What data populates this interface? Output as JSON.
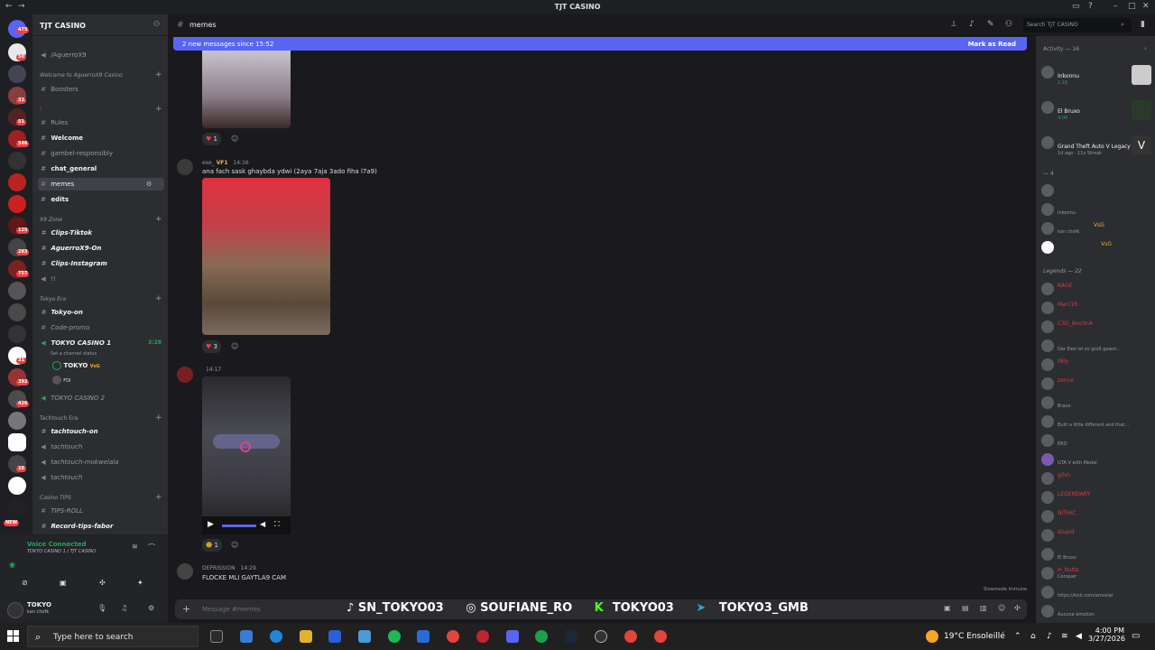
{
  "window": {
    "title": "TJT CASINO"
  },
  "server": {
    "name": "TJT CASINO",
    "badges": [
      "475",
      "50",
      "33",
      "51",
      "546",
      "125",
      "283",
      "757",
      "31",
      "392",
      "426",
      "10",
      "NEW"
    ]
  },
  "channels": {
    "items": [
      {
        "label": "/AguerroX9",
        "type": "text"
      },
      {
        "label": "Welcome to AguerroX9 Casino",
        "type": "category"
      },
      {
        "label": "Boosters",
        "type": "text"
      },
      {
        "label": "!",
        "type": "category"
      },
      {
        "label": "Rules",
        "type": "text"
      },
      {
        "label": "Welcome",
        "type": "text"
      },
      {
        "label": "gambel-responsibly",
        "type": "text"
      },
      {
        "label": "chat_general",
        "type": "text"
      },
      {
        "label": "memes",
        "type": "text"
      },
      {
        "label": "edits",
        "type": "text"
      },
      {
        "label": "X9 Zone",
        "type": "category"
      },
      {
        "label": "Clips-Tiktok",
        "type": "text"
      },
      {
        "label": "AguerroX9-On",
        "type": "text"
      },
      {
        "label": "Clips-Instagram",
        "type": "text"
      },
      {
        "label": "!!",
        "type": "text"
      },
      {
        "label": "Tokyo Era",
        "type": "category"
      },
      {
        "label": "Tokyo-on",
        "type": "text"
      },
      {
        "label": "Code-promo",
        "type": "text"
      },
      {
        "label": "TOKYO CASINO 1",
        "type": "voice"
      },
      {
        "label": "Set a channel status",
        "type": "sub"
      },
      {
        "label": "TOKYO",
        "type": "user"
      },
      {
        "label": "TOKYO CASINO 2",
        "type": "voice"
      },
      {
        "label": "Tachtouch Era",
        "type": "category"
      },
      {
        "label": "tachtouch-on",
        "type": "text"
      },
      {
        "label": "tachtouch",
        "type": "text"
      },
      {
        "label": "tachtouch-mokwelala",
        "type": "text"
      },
      {
        "label": "tachtouch",
        "type": "text"
      },
      {
        "label": "Casino TIPS",
        "type": "category"
      },
      {
        "label": "TIPS-ROLL",
        "type": "text"
      },
      {
        "label": "Record-tips-fabor",
        "type": "text"
      }
    ],
    "voice_time": "3:28",
    "vs_badge": "VsG",
    "fdi_badge": "FDI"
  },
  "voice": {
    "status": "Voice Connected",
    "channel": "TOKYO CASINO 1 / TJT CASINO"
  },
  "user": {
    "name": "TOKYO",
    "status": "kan chofk"
  },
  "chat": {
    "channel_name": "memes",
    "banner_text": "2 new messages since 15:52",
    "banner_action": "Mark as Read",
    "search_placeholder": "Search TJT CASINO",
    "messages": [
      {
        "author": "",
        "time": "",
        "text": "",
        "reaction_count": "1"
      },
      {
        "author": "exe_",
        "time": "14:16",
        "text": "ana fach sask ghaybda ydwi (2aya 7aja 3ado fiha l7a9)",
        "reaction_count": "3",
        "badge": "VF1"
      },
      {
        "author": "",
        "time": "14:17",
        "text": "",
        "reaction_count": "1"
      },
      {
        "author": "DEPRISSION",
        "time": "14:29",
        "text": "FLOCKE MLI GAYTLA9 CAM",
        "reaction_count": ""
      }
    ],
    "composer_placeholder": "Message #memes",
    "slowmode": "Slowmode Immune"
  },
  "overlay": {
    "socials": [
      "SN_TOKYO03",
      "SOUFIANE_RO",
      "TOKYO03",
      "TOKYO3_GMB"
    ]
  },
  "members": {
    "activity_header": "Activity — 16",
    "activity": [
      {
        "name": "Inkonnu",
        "sub": "1:16"
      },
      {
        "name": "El Bruxo",
        "sub": "3:06"
      },
      {
        "name": "Grand Theft Auto V Legacy",
        "sub": "1d ago · 11x Streak"
      }
    ],
    "group1_header": "— 4",
    "group1": [
      {
        "name": "",
        "sub": ""
      },
      {
        "name": "",
        "sub": "Inkonnu"
      },
      {
        "name": "VsG",
        "sub": "kan chofk"
      },
      {
        "name": "VsG",
        "sub": ""
      }
    ],
    "legends_header": "Legends — 22",
    "legends": [
      {
        "name": "KAGE",
        "sub": ""
      },
      {
        "name": "Marc1R",
        "sub": ""
      },
      {
        "name": "C3G_Ano3nA",
        "sub": ""
      },
      {
        "name": "",
        "sub": "Der Esel ist so groß gewor..."
      },
      {
        "name": "Mily",
        "sub": ""
      },
      {
        "name": "zence",
        "sub": ""
      },
      {
        "name": "",
        "sub": "Brave"
      },
      {
        "name": "",
        "sub": "Built a little different and that..."
      },
      {
        "name": "",
        "sub": "ERO"
      },
      {
        "name": "",
        "sub": "GTA V with Medal"
      },
      {
        "name": "gilsh",
        "sub": ""
      },
      {
        "name": "LEGENDARY",
        "sub": ""
      },
      {
        "name": "NITHIC",
        "sub": ""
      },
      {
        "name": "stupid",
        "sub": ""
      },
      {
        "name": "",
        "sub": "El Bruxo"
      },
      {
        "name": "H_Nutts",
        "sub": "Conquer"
      },
      {
        "name": "",
        "sub": "https://kick.com/amoslal"
      },
      {
        "name": "",
        "sub": "Aucune émotion"
      }
    ]
  },
  "taskbar": {
    "search_placeholder": "Type here to search",
    "weather": "19°C  Ensoleillé",
    "time": "4:00 PM",
    "date": "3/27/2026"
  },
  "colors": {
    "accent": "#5865f2",
    "sidebar_bg": "#2b2d31",
    "rail_bg": "#1e1f22",
    "chat_bg": "#1a1a1e",
    "red_name": "#d83c3e"
  }
}
